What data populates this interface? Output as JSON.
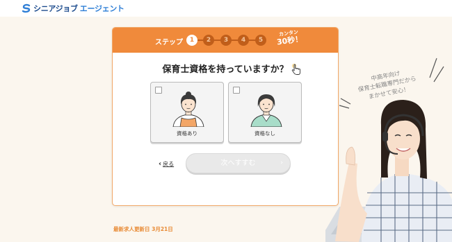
{
  "header": {
    "logo_part1": "シニアジョブ",
    "logo_part2": "エージェント",
    "logo_icon": "s-logo-icon"
  },
  "steps": {
    "label": "ステップ",
    "items": [
      "1",
      "2",
      "3",
      "4",
      "5"
    ],
    "current": 1,
    "badge_line1": "カンタン",
    "badge_line2": "30秒！"
  },
  "question": {
    "text": "保育士資格を持っていますか？"
  },
  "options": [
    {
      "label": "資格あり",
      "icon": "woman-with-apron-icon"
    },
    {
      "label": "資格なし",
      "icon": "woman-in-cardigan-icon"
    }
  ],
  "navigation": {
    "back_label": "戻る",
    "next_label": "次へすすむ"
  },
  "footer": {
    "updated_text": "最新求人更新日 3月21日"
  },
  "promo": {
    "line1": "中高年向け",
    "line2": "保育士転職専門だから",
    "line3": "まかせて安心！"
  },
  "colors": {
    "accent": "#f08a3b",
    "brand": "#1b4a8c",
    "updated": "#e88a34"
  }
}
